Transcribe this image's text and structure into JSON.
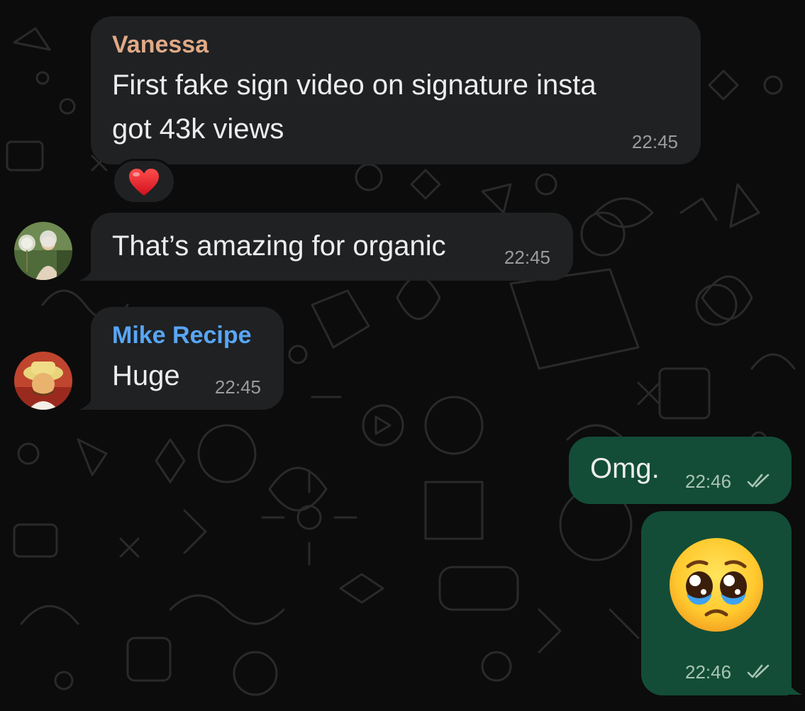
{
  "messages": [
    {
      "sender": "Vanessa",
      "sender_color": "#e0a986",
      "lines": [
        "First fake sign video on signature insta",
        "got 43k views"
      ],
      "time": "22:45",
      "reaction": "heart-emoji"
    },
    {
      "text": "That’s amazing for organic",
      "time": "22:45"
    },
    {
      "sender": "Mike Recipe",
      "sender_color": "#58a6f5",
      "text": "Huge",
      "time": "22:45"
    },
    {
      "text": "Omg.",
      "time": "22:46",
      "status": "read-double-check-icon"
    },
    {
      "emoji": "pleading-face-emoji",
      "time": "22:46",
      "status": "read-double-check-icon"
    }
  ],
  "colors": {
    "incoming_bubble": "#1f2123",
    "outgoing_bubble": "#134d37",
    "background": "#0c0c0c"
  }
}
